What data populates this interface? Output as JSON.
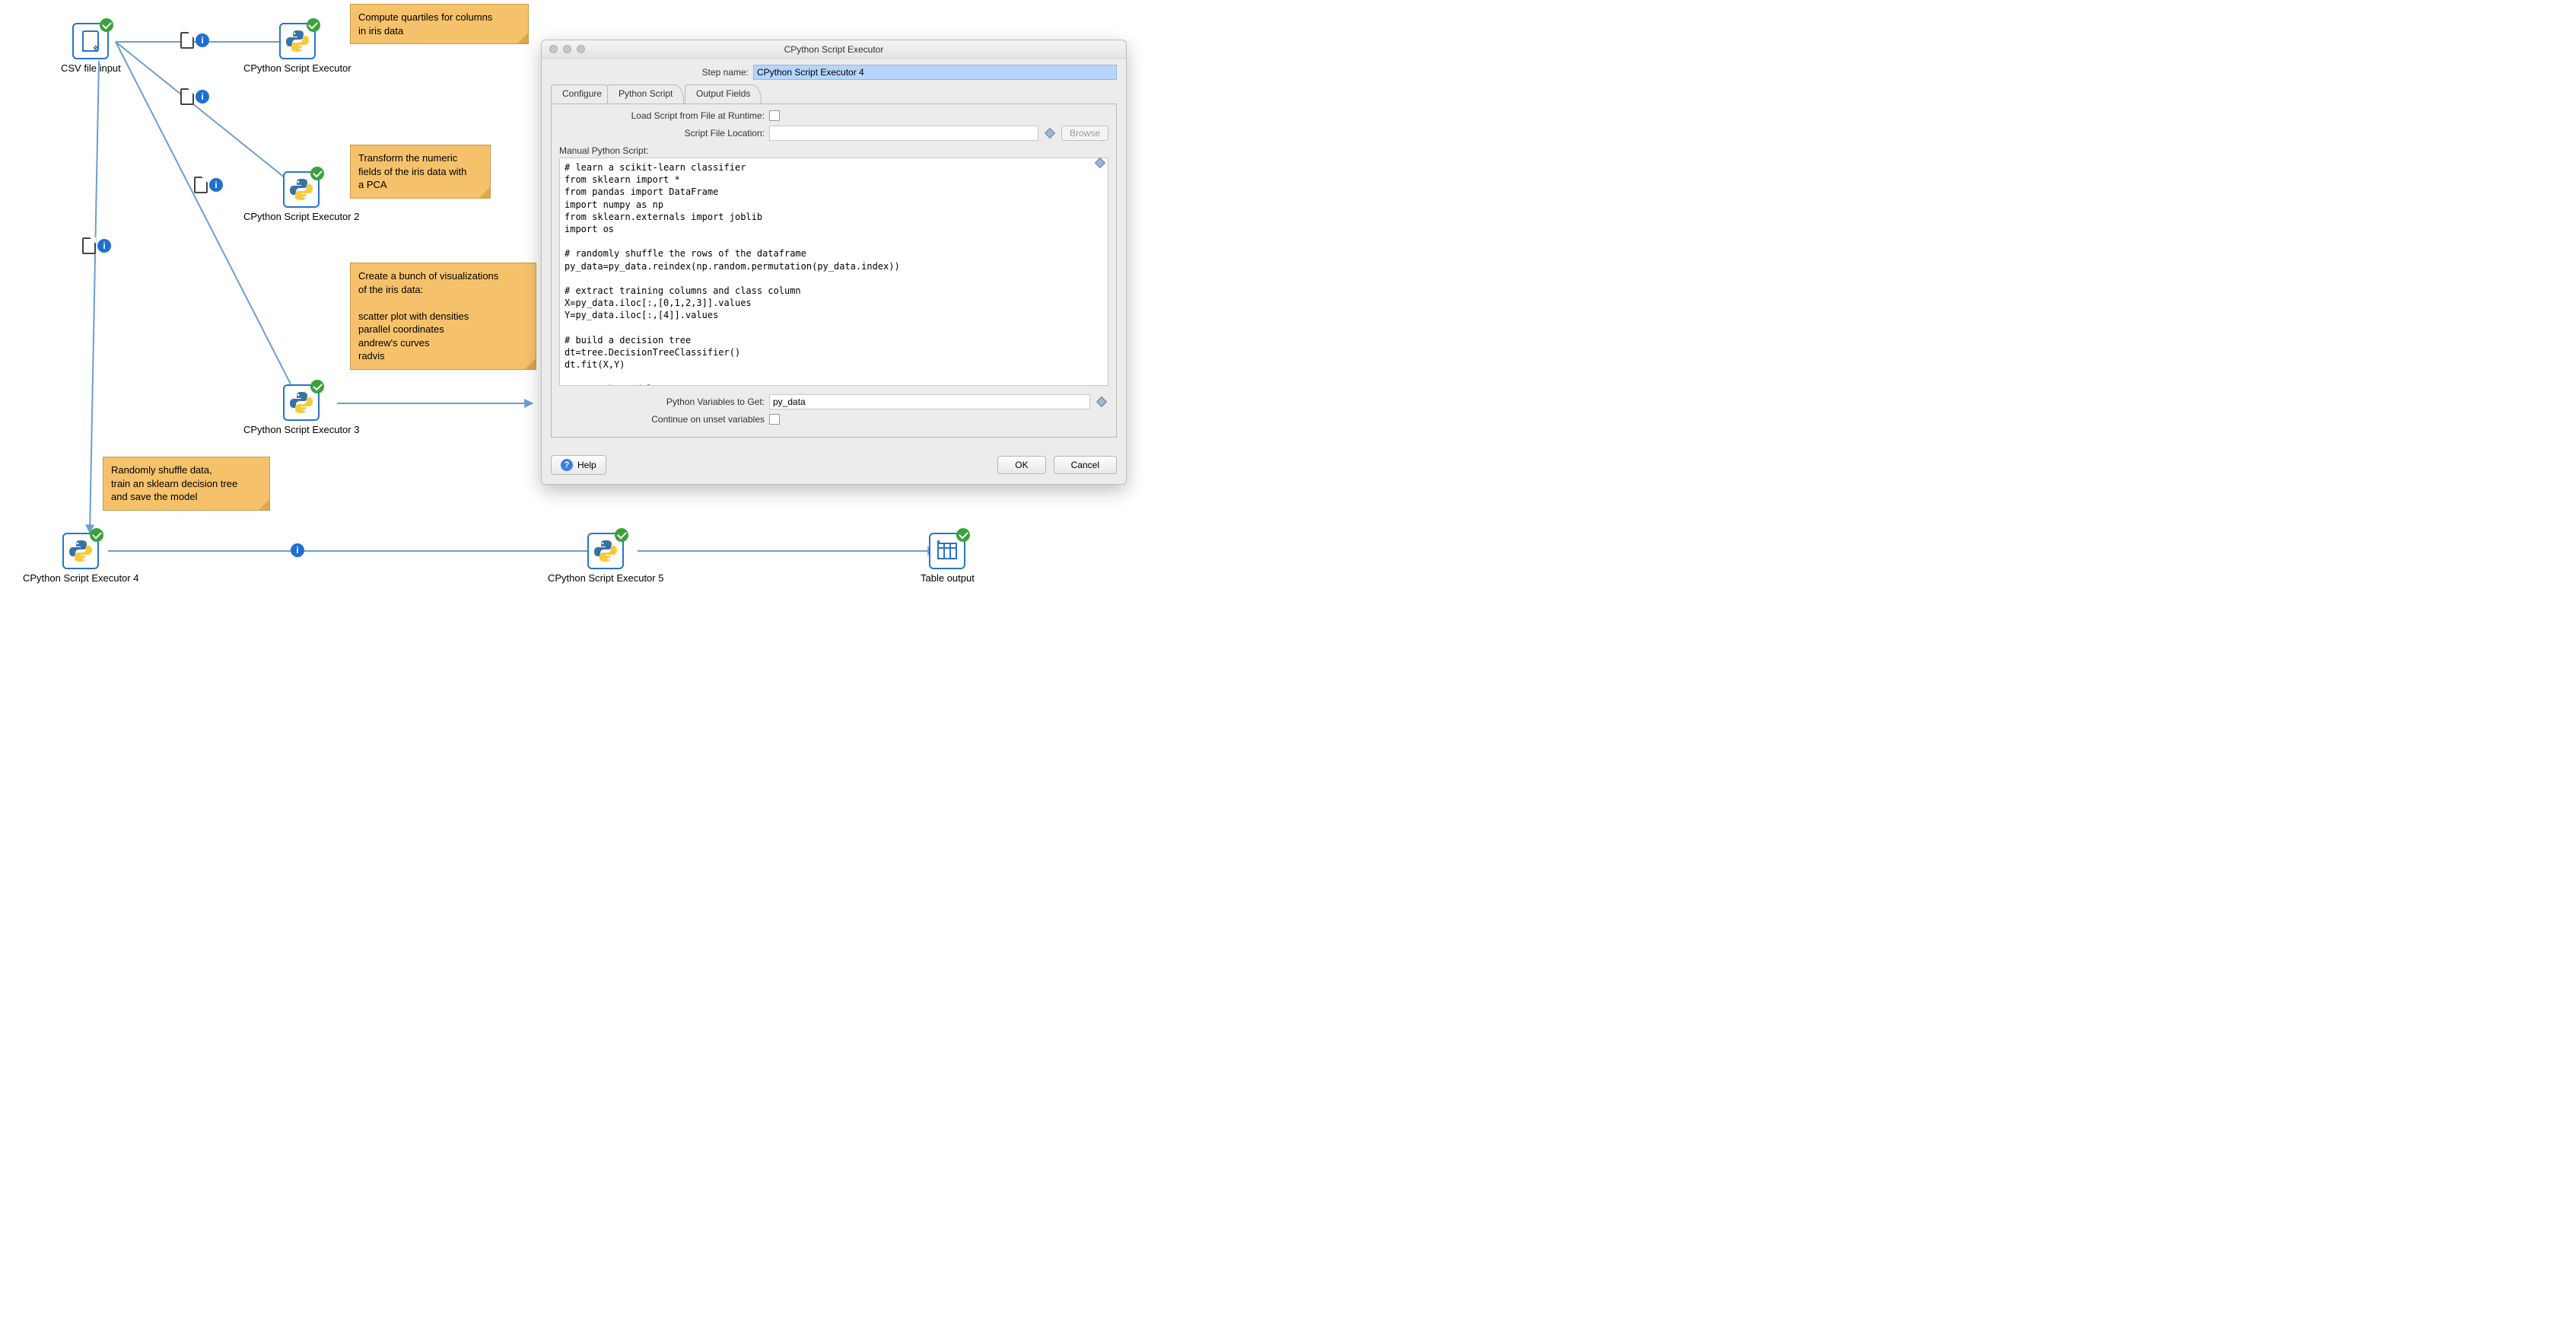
{
  "canvas": {
    "nodes": {
      "csv": {
        "label": "CSV file input"
      },
      "py1": {
        "label": "CPython Script Executor"
      },
      "py2": {
        "label": "CPython Script Executor 2"
      },
      "py3": {
        "label": "CPython Script Executor 3"
      },
      "py4": {
        "label": "CPython Script Executor 4"
      },
      "py5": {
        "label": "CPython Script Executor 5"
      },
      "tbl": {
        "label": "Table output"
      }
    },
    "stickies": {
      "s1": "Compute quartiles for columns\nin iris data",
      "s2": "Transform the numeric\nfields of the iris data with\na PCA",
      "s3": "Create a bunch of visualizations\nof the iris data:\n\nscatter plot with densities\nparallel coordinates\nandrew's curves\nradvis",
      "s4": "Randomly shuffle data,\ntrain an sklearn decision tree\nand save the model"
    },
    "hop_info_glyph": "i"
  },
  "dialog": {
    "title": "CPython Script Executor",
    "step_name_label": "Step name:",
    "step_name_value": "CPython Script Executor 4",
    "tabs": {
      "configure": "Configure",
      "python": "Python Script",
      "output": "Output Fields"
    },
    "labels": {
      "load_runtime": "Load Script from File at Runtime:",
      "file_location": "Script File Location:",
      "manual": "Manual Python Script:",
      "vars_get": "Python Variables to Get:",
      "continue_unset": "Continue on unset variables"
    },
    "browse": "Browse",
    "script": "# learn a scikit-learn classifier\nfrom sklearn import *\nfrom pandas import DataFrame\nimport numpy as np\nfrom sklearn.externals import joblib\nimport os\n\n# randomly shuffle the rows of the dataframe\npy_data=py_data.reindex(np.random.permutation(py_data.index))\n\n# extract training columns and class column\nX=py_data.iloc[:,[0,1,2,3]].values\nY=py_data.iloc[:,[4]].values\n\n# build a decision tree\ndt=tree.DecisionTreeClassifier()\ndt.fit(X,Y)\n\n# save the model\nfilename='${Internal.Transformation.Filename.Directory}/dt.sklearn'\nif os.name == 'nt':\n    filename=filename[8:] # strip file:/// off\nelse:\n    filename=filename[7:] # strip the \"file://\" off (probably needs changing for windows paths...)\njoblib.dump(dt,filename)\n",
    "vars_value": "py_data",
    "buttons": {
      "help": "Help",
      "ok": "OK",
      "cancel": "Cancel"
    }
  }
}
